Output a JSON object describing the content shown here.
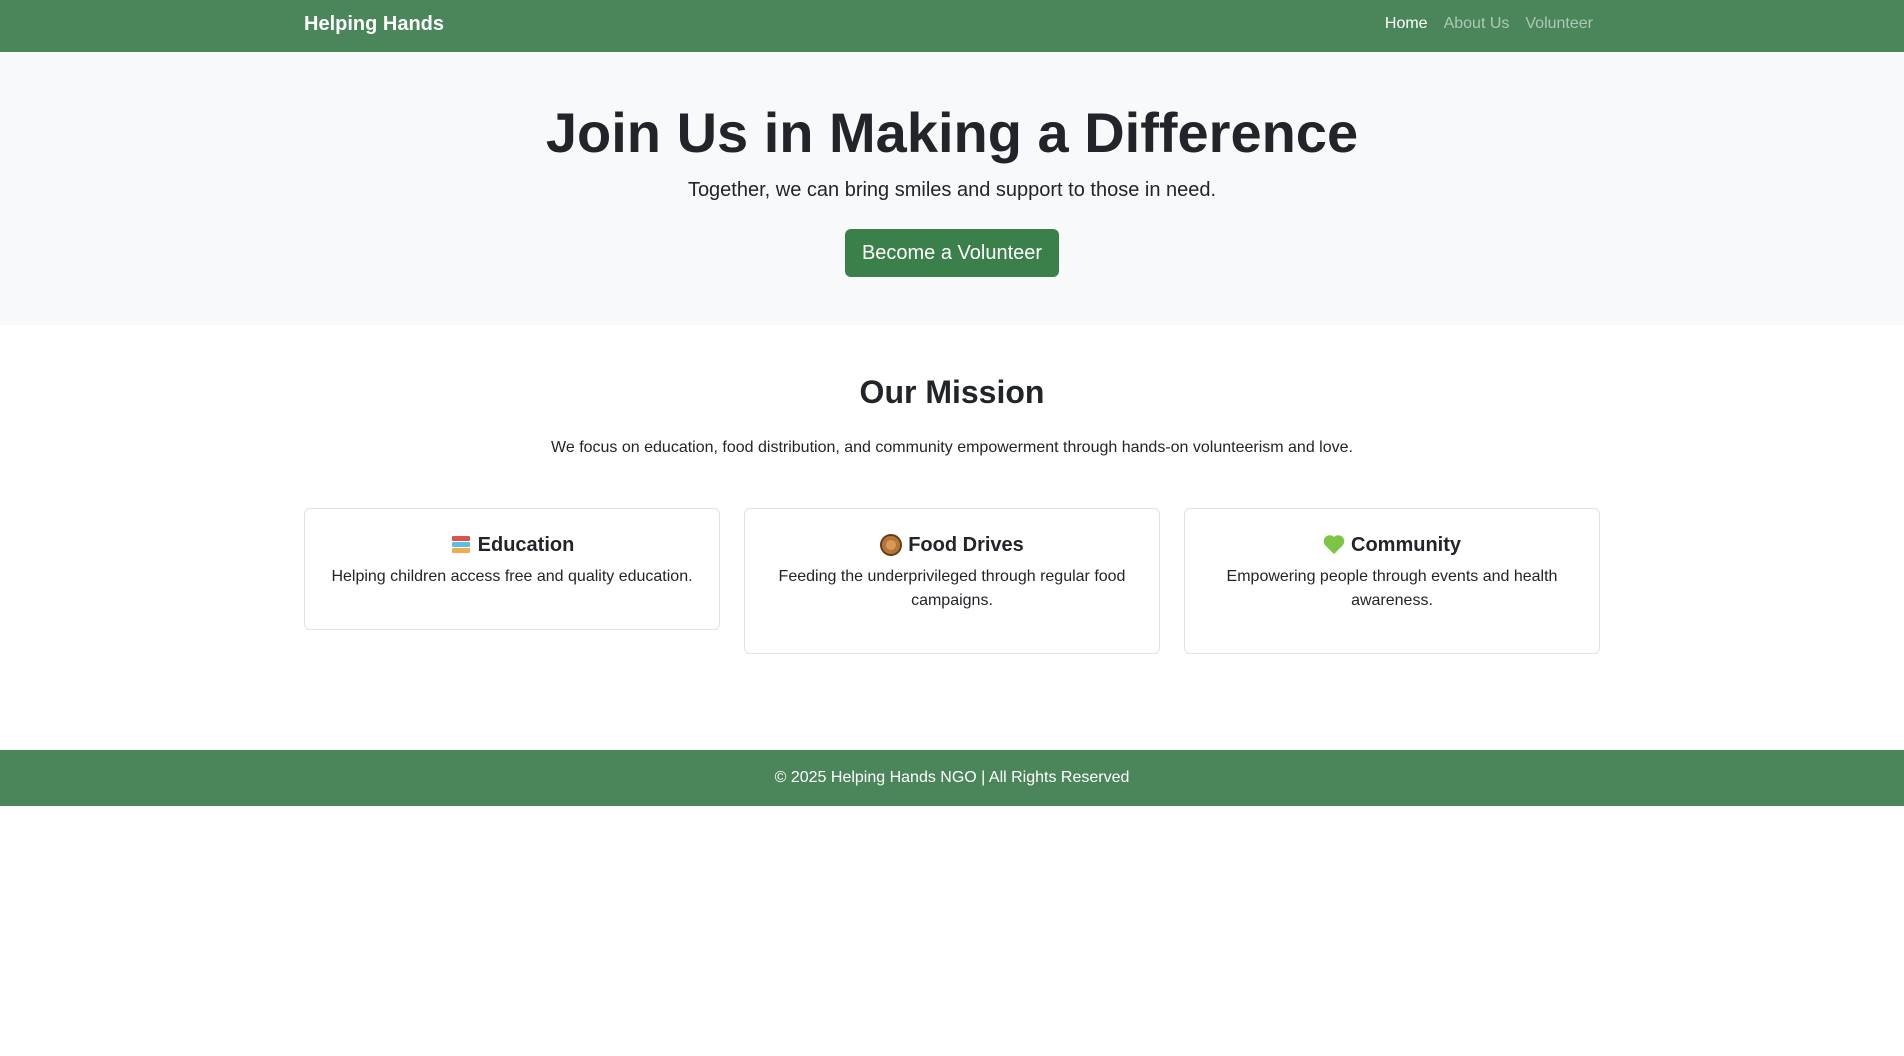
{
  "navbar": {
    "brand": "Helping Hands",
    "links": [
      {
        "label": "Home",
        "active": true
      },
      {
        "label": "About Us",
        "active": false
      },
      {
        "label": "Volunteer",
        "active": false
      }
    ]
  },
  "hero": {
    "title": "Join Us in Making a Difference",
    "subtitle": "Together, we can bring smiles and support to those in need.",
    "button_label": "Become a Volunteer"
  },
  "mission": {
    "title": "Our Mission",
    "text": "We focus on education, food distribution, and community empowerment through hands-on volunteerism and love.",
    "cards": [
      {
        "icon": "books-icon",
        "title": "Education",
        "text": "Helping children access free and quality education."
      },
      {
        "icon": "food-bowl-icon",
        "title": "Food Drives",
        "text": "Feeding the underprivileged through regular food campaigns."
      },
      {
        "icon": "green-heart-icon",
        "title": "Community",
        "text": "Empowering people through events and health awareness."
      }
    ]
  },
  "footer": {
    "text": "© 2025 Helping Hands NGO | All Rights Reserved"
  },
  "colors": {
    "primary": "#4a8659",
    "button": "#3b7f4b",
    "hero_bg": "#f8f9fa"
  }
}
